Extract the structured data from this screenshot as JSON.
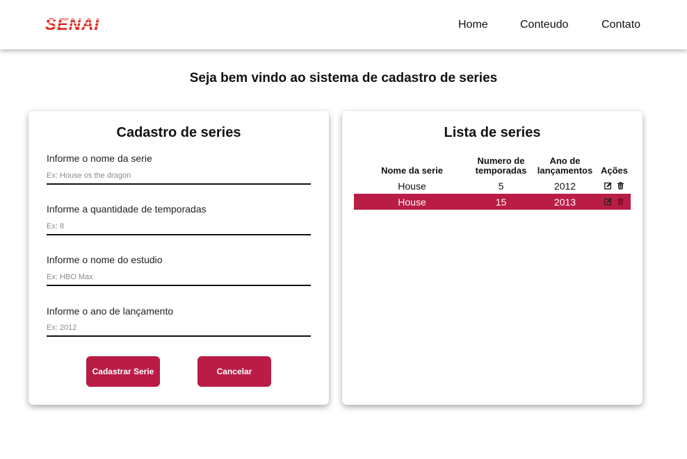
{
  "header": {
    "logo_text": "SENAI",
    "nav": [
      "Home",
      "Conteudo",
      "Contato"
    ]
  },
  "welcome": "Seja bem vindo ao sistema de cadastro de series",
  "form": {
    "title": "Cadastro de series",
    "fields": [
      {
        "label": "Informe o nome da serie",
        "placeholder": "Ex: House os the dragon",
        "value": ""
      },
      {
        "label": "Informe a quantidade de temporadas",
        "placeholder": "Ex: 8",
        "value": ""
      },
      {
        "label": "Informe o nome do estudio",
        "placeholder": "Ex: HBO Max",
        "value": ""
      },
      {
        "label": "Informe o ano de lançamento",
        "placeholder": "Ex: 2012",
        "value": ""
      }
    ],
    "submit_label": "Cadastrar Serie",
    "cancel_label": "Cancelar"
  },
  "list": {
    "title": "Lista de series",
    "headers": {
      "name": "Nome da serie",
      "seasons_line1": "Numero de",
      "seasons_line2": "temporadas",
      "year_line1": "Ano de",
      "year_line2": "lançamentos",
      "actions": "Ações"
    },
    "rows": [
      {
        "name": "House",
        "seasons": "5",
        "year": "2012",
        "selected": false
      },
      {
        "name": "House",
        "seasons": "15",
        "year": "2013",
        "selected": true
      }
    ],
    "row_icons": [
      "edit-icon",
      "trash-icon"
    ]
  },
  "colors": {
    "brand_red": "#b91c45",
    "logo_red": "#e2231a"
  }
}
